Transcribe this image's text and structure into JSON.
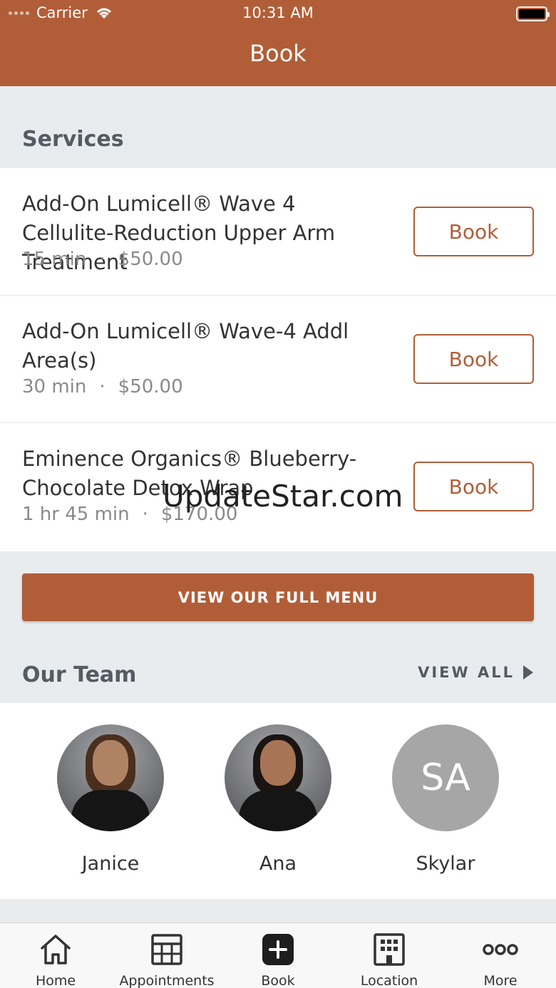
{
  "status_bar": {
    "carrier": "Carrier",
    "time": "10:31 AM"
  },
  "nav": {
    "title": "Book"
  },
  "services": {
    "title": "Services",
    "items": [
      {
        "name": "Add-On Lumicell® Wave 4 Cellulite-Reduction Upper Arm Treatment",
        "duration": "15 min",
        "separator": "·",
        "price": "$50.00",
        "button": "Book"
      },
      {
        "name": "Add-On Lumicell® Wave-4 Addl Area(s)",
        "duration": "30 min",
        "separator": "·",
        "price": "$50.00",
        "button": "Book"
      },
      {
        "name": "Eminence Organics® Blueberry-Chocolate Detox Wrap",
        "duration": "1 hr 45 min",
        "separator": "·",
        "price": "$170.00",
        "button": "Book"
      }
    ],
    "full_menu_button": "VIEW OUR FULL MENU"
  },
  "watermark": "UpdateStar.com",
  "team": {
    "title": "Our Team",
    "view_all": "VIEW ALL",
    "members": [
      {
        "name": "Janice",
        "avatar_initials": ""
      },
      {
        "name": "Ana",
        "avatar_initials": ""
      },
      {
        "name": "Skylar",
        "avatar_initials": "SA"
      }
    ]
  },
  "tabbar": {
    "items": [
      {
        "label": "Home",
        "icon": "home-icon"
      },
      {
        "label": "Appointments",
        "icon": "calendar-grid-icon"
      },
      {
        "label": "Book",
        "icon": "plus-icon"
      },
      {
        "label": "Location",
        "icon": "building-icon"
      },
      {
        "label": "More",
        "icon": "more-dots-icon"
      }
    ]
  },
  "colors": {
    "brand": "#b15e38",
    "background": "#e9ecef",
    "avatar_placeholder": "#a6a6a6"
  }
}
